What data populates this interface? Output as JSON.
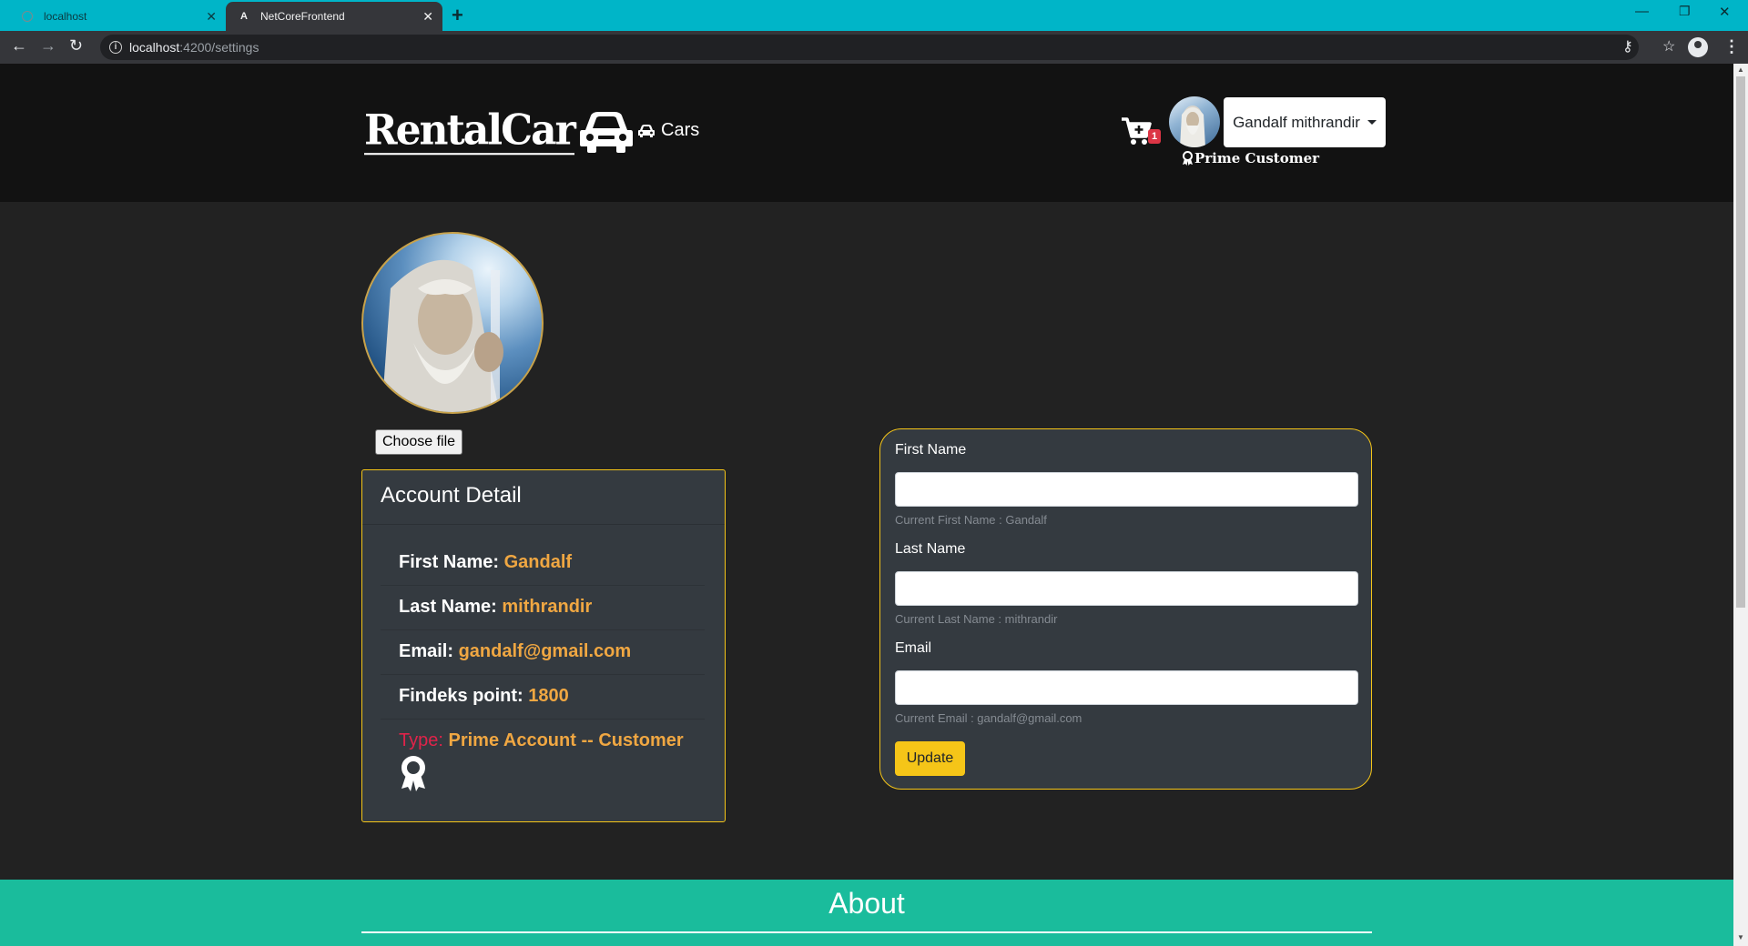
{
  "browser": {
    "tabs": [
      {
        "title": "localhost",
        "active": false
      },
      {
        "title": "NetCoreFrontend",
        "favicon": "A",
        "active": true
      }
    ],
    "url_host": "localhost",
    "url_path": ":4200/settings"
  },
  "header": {
    "logo_text": "RentalCar",
    "nav_cars": "Cars",
    "cart_count": "1",
    "user_name": "Gandalf mithrandir",
    "membership": "Prime Customer"
  },
  "profile": {
    "choose_file": "Choose file"
  },
  "account": {
    "title": "Account Detail",
    "items": [
      {
        "label": "First Name:",
        "value": "Gandalf"
      },
      {
        "label": "Last Name:",
        "value": "mithrandir"
      },
      {
        "label": "Email:",
        "value": "gandalf@gmail.com"
      },
      {
        "label": "Findeks point:",
        "value": "1800"
      },
      {
        "label": "Type:",
        "value": "Prime Account -- Customer"
      }
    ]
  },
  "form": {
    "first_name_label": "First Name",
    "first_name_help": "Current First Name : Gandalf",
    "last_name_label": "Last Name",
    "last_name_help": "Current Last Name : mithrandir",
    "email_label": "Email",
    "email_help": "Current Email : gandalf@gmail.com",
    "update_label": "Update"
  },
  "footer": {
    "about_title": "About"
  },
  "colors": {
    "accent": "#f5c518",
    "value_orange": "#f0a742",
    "type_red": "#e0234a",
    "about_teal": "#1abc9c",
    "tab_strip": "#00b5c8"
  }
}
